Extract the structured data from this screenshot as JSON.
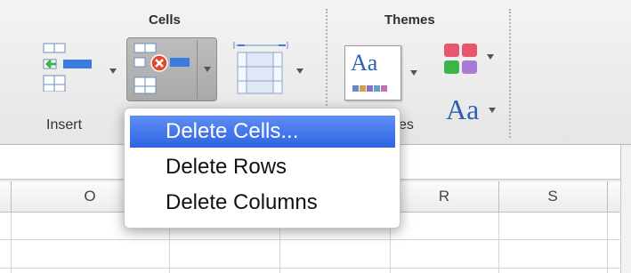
{
  "ribbon": {
    "groups": {
      "cells": {
        "title": "Cells",
        "insert_label": "Insert"
      },
      "themes": {
        "title": "Themes",
        "themes_partial_label": "es",
        "fonts_label": "Aa"
      }
    },
    "theme_preview_text": "Aa"
  },
  "columns": [
    "O",
    "R",
    "S"
  ],
  "menu": {
    "items": [
      {
        "label": "Delete Cells...",
        "selected": true
      },
      {
        "label": "Delete Rows",
        "selected": false
      },
      {
        "label": "Delete Columns",
        "selected": false
      }
    ]
  },
  "colors": {
    "menu_highlight": "#3a6fe6",
    "delete_badge": "#e0492f",
    "accent_blue": "#3a7be0"
  }
}
